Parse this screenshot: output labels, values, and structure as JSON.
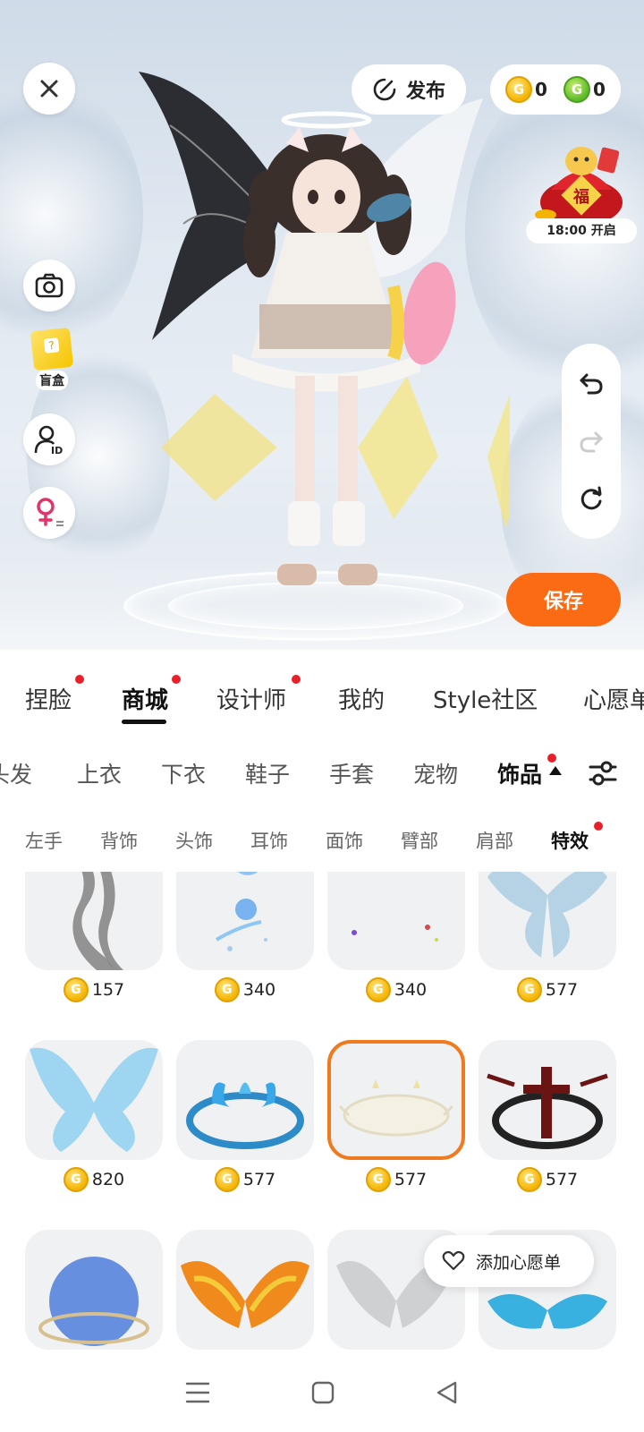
{
  "toolbar": {
    "publish_label": "发布",
    "gold_coin_count": "0",
    "green_coin_count": "0",
    "coin_glyph": "G",
    "save_label": "保存"
  },
  "lucky_bag": {
    "label": "18:00 开启",
    "glyph": "福"
  },
  "side_tools": {
    "blind_box_label": "盲盒",
    "id_glyph": "ID"
  },
  "main_tabs": [
    {
      "label": "捏脸"
    },
    {
      "label": "商城"
    },
    {
      "label": "设计师"
    },
    {
      "label": "我的"
    },
    {
      "label": "Style社区"
    },
    {
      "label": "心愿单"
    }
  ],
  "category_tabs": [
    {
      "label": "头发"
    },
    {
      "label": "上衣"
    },
    {
      "label": "下衣"
    },
    {
      "label": "鞋子"
    },
    {
      "label": "手套"
    },
    {
      "label": "宠物"
    },
    {
      "label": "饰品"
    }
  ],
  "sub_tabs": [
    {
      "label": "左手"
    },
    {
      "label": "背饰"
    },
    {
      "label": "头饰"
    },
    {
      "label": "耳饰"
    },
    {
      "label": "面饰"
    },
    {
      "label": "臂部"
    },
    {
      "label": "肩部"
    },
    {
      "label": "特效"
    }
  ],
  "items": [
    {
      "price": "157"
    },
    {
      "price": "340"
    },
    {
      "price": "340"
    },
    {
      "price": "577"
    },
    {
      "price": "820"
    },
    {
      "price": "577"
    },
    {
      "price": "577"
    },
    {
      "price": "577"
    }
  ],
  "wishlist_popup": {
    "label": "添加心愿单"
  },
  "colors": {
    "accent": "#fa6b14",
    "selected_border": "#f07a1e",
    "red_dot": "#e8202a"
  },
  "icons": [
    "close-icon",
    "publish-icon",
    "camera-icon",
    "blind-box-icon",
    "id-card-icon",
    "female-switch-icon",
    "undo-icon",
    "redo-icon",
    "reset-icon",
    "filter-icon",
    "heart-icon",
    "menu-nav-icon",
    "home-nav-icon",
    "back-nav-icon"
  ]
}
